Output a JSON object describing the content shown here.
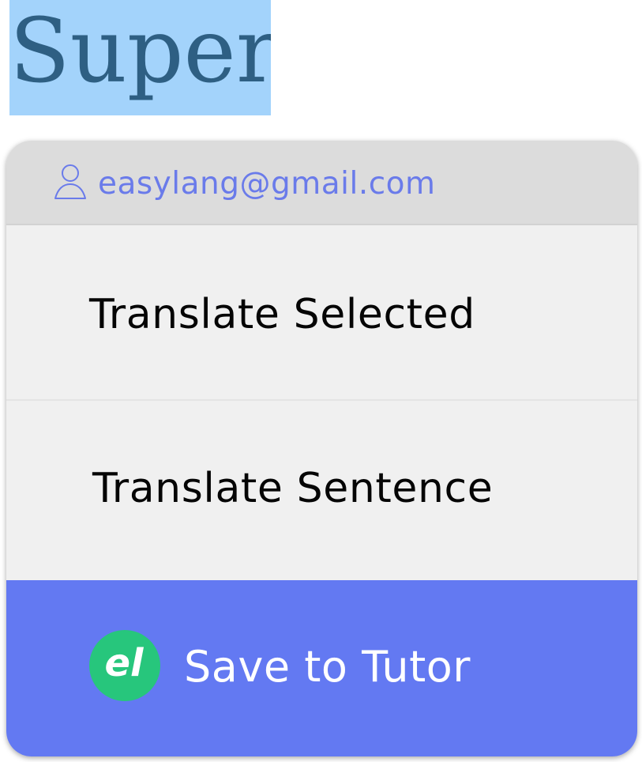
{
  "highlight": {
    "selected_text": "Super"
  },
  "menu": {
    "account": {
      "email": "easylang@gmail.com",
      "icon": "user-outline-icon",
      "color": "#6a7bea"
    },
    "items": [
      {
        "label": "Translate Selected"
      },
      {
        "label": "Translate Sentence"
      }
    ],
    "save": {
      "label": "Save to Tutor",
      "logo_text": "el",
      "logo_icon": "easylang-logo-icon",
      "background_color": "#6379f2",
      "logo_color": "#27c67c"
    }
  },
  "colors": {
    "selection_background": "#a3d3fb",
    "selection_text": "#2e5f83",
    "menu_background": "#f0f0f0",
    "header_background": "#dcdcdc"
  }
}
